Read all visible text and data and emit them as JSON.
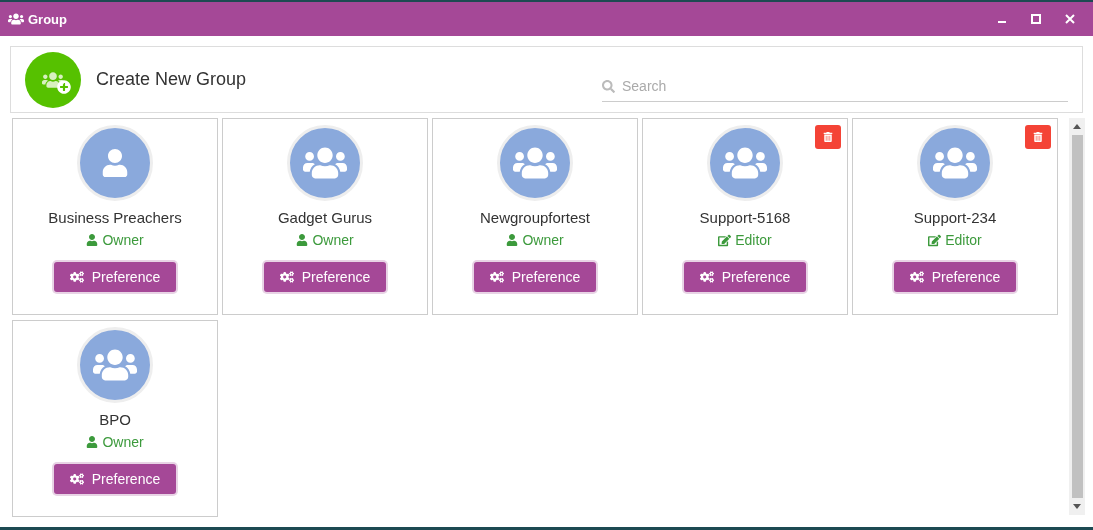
{
  "window": {
    "title": "Group"
  },
  "create_button": {
    "label": "Create New Group"
  },
  "search": {
    "placeholder": "Search"
  },
  "groups": [
    {
      "name": "Business Preachers",
      "role": "Owner",
      "kind": "owner",
      "avatar": {
        "kind": "single"
      },
      "deletable": false,
      "button": "Preference"
    },
    {
      "name": "Gadget Gurus",
      "role": "Owner",
      "kind": "owner",
      "avatar": {
        "kind": "group"
      },
      "deletable": false,
      "button": "Preference"
    },
    {
      "name": "Newgroupfortest",
      "role": "Owner",
      "kind": "owner",
      "avatar": {
        "kind": "group"
      },
      "deletable": false,
      "button": "Preference"
    },
    {
      "name": "Support-5168",
      "role": "Editor",
      "kind": "editor",
      "avatar": {
        "kind": "group"
      },
      "deletable": true,
      "button": "Preference"
    },
    {
      "name": "Support-234",
      "role": "Editor",
      "kind": "editor",
      "avatar": {
        "kind": "group"
      },
      "deletable": true,
      "button": "Preference"
    },
    {
      "name": "BPO",
      "role": "Owner",
      "kind": "owner",
      "avatar": {
        "kind": "group"
      },
      "deletable": false,
      "button": "Preference"
    }
  ]
}
